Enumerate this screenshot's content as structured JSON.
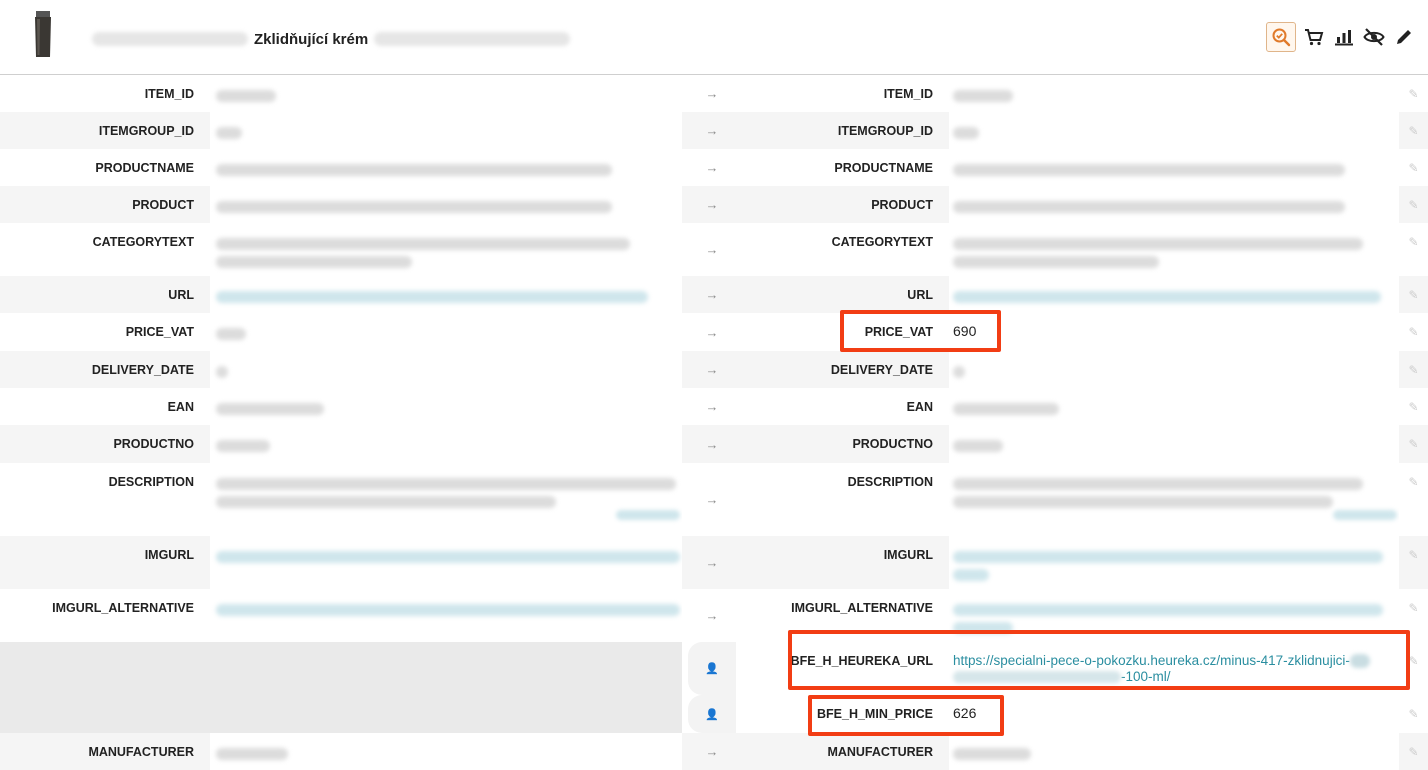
{
  "header": {
    "title": "Zklidňující krém",
    "tools": [
      {
        "icon": "search-check-icon"
      },
      {
        "icon": "cart-icon"
      },
      {
        "icon": "bar-chart-icon"
      },
      {
        "icon": "eye-off-icon"
      },
      {
        "icon": "pencil-icon"
      }
    ]
  },
  "left_rows": [
    {
      "key": "ITEM_ID"
    },
    {
      "key": "ITEMGROUP_ID"
    },
    {
      "key": "PRODUCTNAME"
    },
    {
      "key": "PRODUCT"
    },
    {
      "key": "CATEGORYTEXT"
    },
    {
      "key": "URL"
    },
    {
      "key": "PRICE_VAT"
    },
    {
      "key": "DELIVERY_DATE"
    },
    {
      "key": "EAN"
    },
    {
      "key": "PRODUCTNO"
    },
    {
      "key": "DESCRIPTION"
    },
    {
      "key": "IMGURL"
    },
    {
      "key": "IMGURL_ALTERNATIVE"
    },
    {
      "key": "MANUFACTURER"
    }
  ],
  "right_rows": {
    "item_id": "ITEM_ID",
    "itemgroup_id": "ITEMGROUP_ID",
    "productname": "PRODUCTNAME",
    "product": "PRODUCT",
    "categorytext": "CATEGORYTEXT",
    "url": "URL",
    "price_vat": {
      "key": "PRICE_VAT",
      "value": "690"
    },
    "delivery_date": "DELIVERY_DATE",
    "ean": "EAN",
    "productno": "PRODUCTNO",
    "description": "DESCRIPTION",
    "imgurl": "IMGURL",
    "imgurl_alternative": "IMGURL_ALTERNATIVE",
    "bfe_h_heureka_url": {
      "key": "BFE_H_HEUREKA_URL",
      "value_line1": "https://specialni-pece-o-pokozku.heureka.cz/minus-417-zklidnujici-",
      "value_line2": "-100-ml/"
    },
    "bfe_h_min_price": {
      "key": "BFE_H_MIN_PRICE",
      "value": "626"
    },
    "manufacturer": "MANUFACTURER"
  },
  "colors": {
    "highlight": "#f23d14",
    "link": "#2a8ea0",
    "accent": "#e8a060"
  }
}
